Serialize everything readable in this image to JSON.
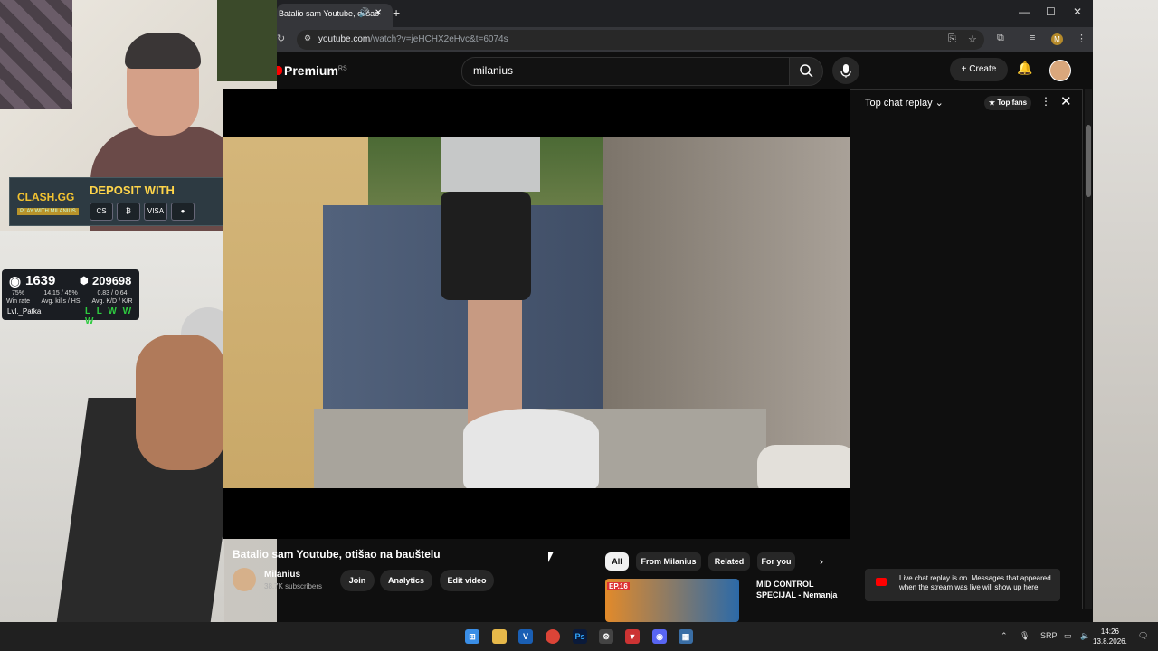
{
  "overlay": {
    "banner_brand": "CLASH.GG",
    "banner_sub": "PLAY WITH MILANIUS",
    "banner_text": "DEPOSIT WITH",
    "pay_methods": [
      "CS",
      "₿",
      "VISA",
      "●"
    ],
    "stats": {
      "rating": "1639",
      "points": "209698",
      "win_rate": "75%",
      "win_rate_label": "Win rate",
      "kills_hs": "14.15 / 45%",
      "kills_hs_label": "Avg. kills / HS",
      "kd_kr": "0.83 / 0.64",
      "kd_kr_label": "Avg. K/D / K/R",
      "username": "Lvl._Patka",
      "results": "L L W W W"
    }
  },
  "browser": {
    "tab_title": "Batalio sam Youtube, otišao",
    "url_host": "youtube.com",
    "url_path": "/watch?v=jeHCHX2eHvc&t=6074s",
    "profile_initial": "M"
  },
  "youtube": {
    "logo_text": "Premium",
    "logo_region": "RS",
    "search_value": "milanius",
    "create_label": "+ Create",
    "video_title": "Batalio sam Youtube, otišao na bauštelu",
    "channel_name": "Milanius",
    "channel_subs": "38.7K subscribers",
    "buttons": [
      "Join",
      "Analytics",
      "Edit video"
    ],
    "chips": [
      "All",
      "From Milanius",
      "Related",
      "For you"
    ],
    "recommended": {
      "thumb_badge": "EP.16",
      "title": "MID CONTROL SPECIJAL - Nemanja"
    }
  },
  "chat": {
    "header": "Top chat replay",
    "top_fans": "Top fans",
    "note": "Live chat replay is on. Messages that appeared when the stream was live will show up here."
  },
  "taskbar": {
    "language": "SRP",
    "time": "14:26",
    "date": "13.8.2026."
  },
  "colors": {
    "youtube_red": "#ff0000",
    "background": "#0f0f0f",
    "chip_bg": "#272727",
    "win_green": "#2ecc40"
  }
}
